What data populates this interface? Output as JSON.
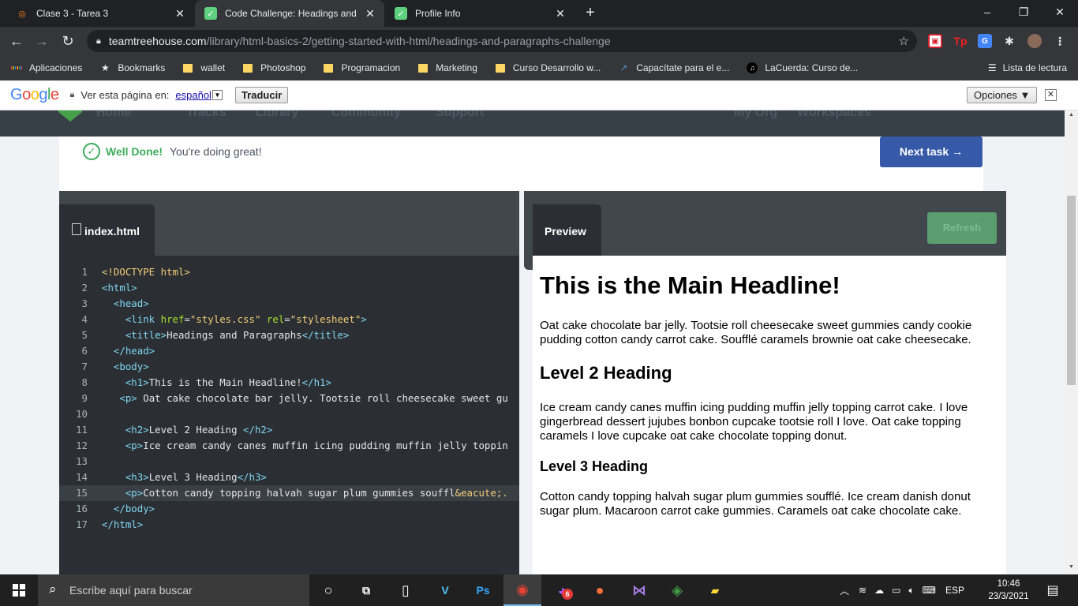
{
  "browser": {
    "tabs": [
      {
        "title": "Clase 3 - Tarea 3",
        "close": "✕"
      },
      {
        "title": "Code Challenge: Headings and Pa",
        "close": "✕"
      },
      {
        "title": "Profile Info",
        "close": "✕"
      }
    ],
    "new_tab": "+",
    "window": {
      "minimize": "–",
      "maximize": "❐",
      "close": "✕"
    },
    "url_host": "teamtreehouse.com",
    "url_path": "/library/html-basics-2/getting-started-with-html/headings-and-paragraphs-challenge",
    "bookmarks": [
      "Aplicaciones",
      "Bookmarks",
      "wallet",
      "Photoshop",
      "Programacion",
      "Marketing",
      "Curso Desarrollo w...",
      "Capacítate para el e...",
      "LaCuerda: Curso de..."
    ],
    "reading_list": "Lista de lectura"
  },
  "translate_bar": {
    "logo": "Google",
    "prompt": "Ver esta página en:",
    "language": "español",
    "translate_button": "Traducir",
    "options_button": "Opciones ▼",
    "close": "✕"
  },
  "page": {
    "nav_ghost": [
      "Home",
      "Tracks",
      "Library",
      "Community",
      "Support",
      "My Org",
      "Workspaces"
    ],
    "status_strong": "Well Done!",
    "status_text": "You're doing great!",
    "next_button": "Next task →",
    "editor": {
      "file_tab": "index.html",
      "lines": [
        "1",
        "2",
        "3",
        "4",
        "5",
        "6",
        "7",
        "8",
        "9",
        "10",
        "11",
        "12",
        "13",
        "14",
        "15",
        "16",
        "17"
      ],
      "code": {
        "l1": "<!DOCTYPE html>",
        "l2a": "<html>",
        "l3a": "<head>",
        "l4a": "<link ",
        "l4b": "href",
        "l4c": "=",
        "l4d": "\"styles.css\"",
        "l4e": " rel",
        "l4f": "=",
        "l4g": "\"stylesheet\"",
        "l4h": ">",
        "l5a": "<title>",
        "l5b": "Headings and Paragraphs",
        "l5c": "</title>",
        "l6a": "</head>",
        "l7a": "<body>",
        "l8a": "<h1>",
        "l8b": "This is the Main Headline!",
        "l8c": "</h1>",
        "l9a": "<p>",
        "l9b": " Oat cake chocolate bar jelly. Tootsie roll cheesecake sweet gu",
        "l11a": "<h2>",
        "l11b": "Level 2 Heading ",
        "l11c": "</h2>",
        "l12a": "<p>",
        "l12b": "Ice cream candy canes muffin icing pudding muffin jelly toppin",
        "l14a": "<h3>",
        "l14b": "Level 3 Heading",
        "l14c": "</h3>",
        "l15a": "<p>",
        "l15b": "Cotton candy topping halvah sugar plum gummies souffl",
        "l15c": "&eacute;.",
        "l16a": "</body>",
        "l17a": "</html>"
      }
    },
    "preview": {
      "tab": "Preview",
      "refresh": "Refresh",
      "h1": "This is the Main Headline!",
      "p1": "Oat cake chocolate bar jelly. Tootsie roll cheesecake sweet gummies candy cookie pudding cotton candy carrot cake. Soufflé caramels brownie oat cake cheesecake.",
      "h2": "Level 2 Heading",
      "p2": "Ice cream candy canes muffin icing pudding muffin jelly topping carrot cake. I love gingerbread dessert jujubes bonbon cupcake tootsie roll I love. Oat cake topping caramels I love cupcake oat cake chocolate topping donut.",
      "h3": "Level 3 Heading",
      "p3": "Cotton candy topping halvah sugar plum gummies soufflé. Ice cream danish donut sugar plum. Macaroon carrot cake gummies. Caramels oat cake chocolate cake."
    }
  },
  "taskbar": {
    "search_placeholder": "Escribe aquí para buscar",
    "badge": "6",
    "language": "ESP",
    "time": "10:46",
    "date": "23/3/2021"
  },
  "colors": {
    "accent_green": "#3cab5c",
    "next_button": "#3659a8",
    "editor_bg": "#2b2f33",
    "chrome_dark": "#202124"
  }
}
